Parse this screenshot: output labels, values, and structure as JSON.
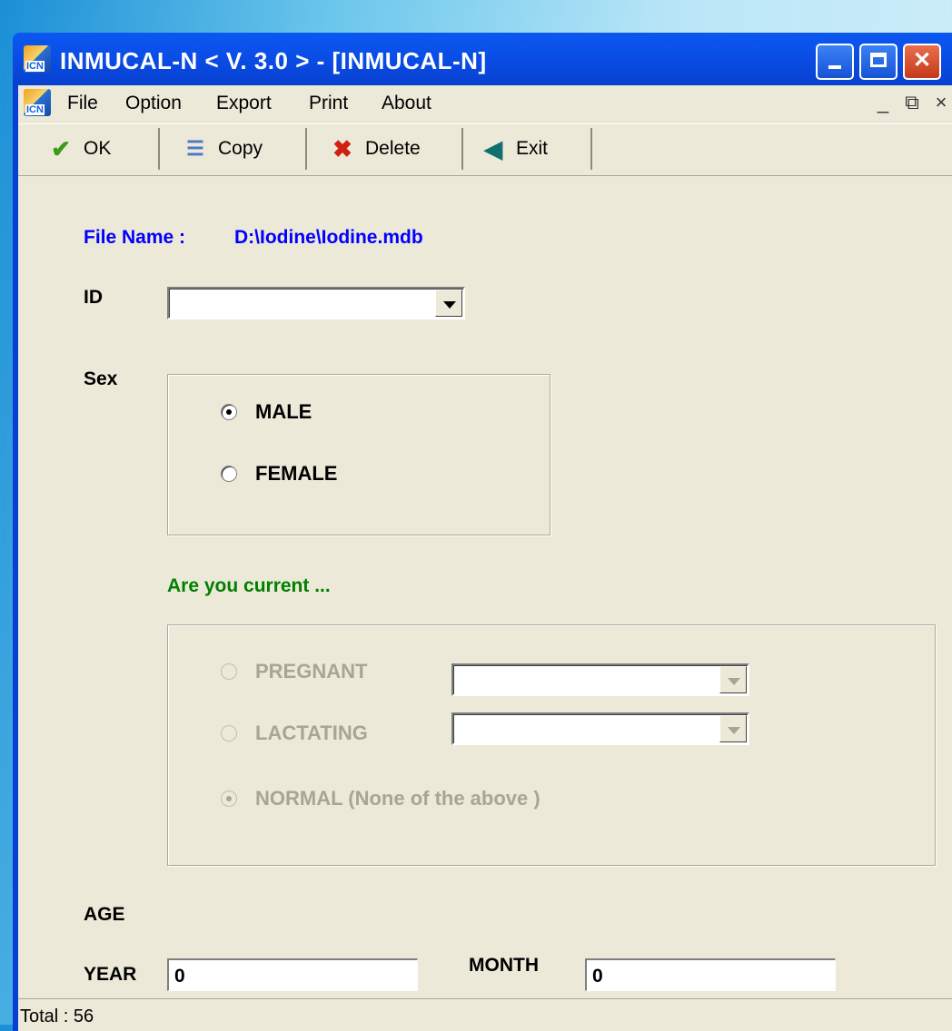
{
  "window": {
    "title": "INMUCAL-N    < V. 3.0 > - [INMUCAL-N]",
    "icon_text": "ICN"
  },
  "menu": {
    "items": [
      "File",
      "Option",
      "Export",
      "Print",
      "About"
    ],
    "mdi_min": "_",
    "mdi_restore": "⧉",
    "mdi_close": "×"
  },
  "toolbar": {
    "ok": "OK",
    "copy": "Copy",
    "delete": "Delete",
    "exit": "Exit"
  },
  "form": {
    "file_name_label": "File Name :",
    "file_name_value": "D:\\Iodine\\Iodine.mdb",
    "id_label": "ID",
    "id_value": "",
    "sex_label": "Sex",
    "sex_options": [
      {
        "label": "MALE",
        "checked": true
      },
      {
        "label": "FEMALE",
        "checked": false
      }
    ],
    "current_label": "Are you current ...",
    "status_options": [
      {
        "label": "PREGNANT",
        "checked": false
      },
      {
        "label": "LACTATING",
        "checked": false
      },
      {
        "label": "NORMAL (None of the above )",
        "checked": true
      }
    ],
    "age_label": "AGE",
    "year_label": "YEAR",
    "year_value": "0",
    "month_label": "MONTH",
    "month_value": "0"
  },
  "status": {
    "total": "Total : 56"
  },
  "colors": {
    "titlebar": "#0a4fe8",
    "client_bg": "#ece9d8",
    "file_name": "#0000ff",
    "current_label": "#008000",
    "disabled_text": "#a8a595"
  }
}
